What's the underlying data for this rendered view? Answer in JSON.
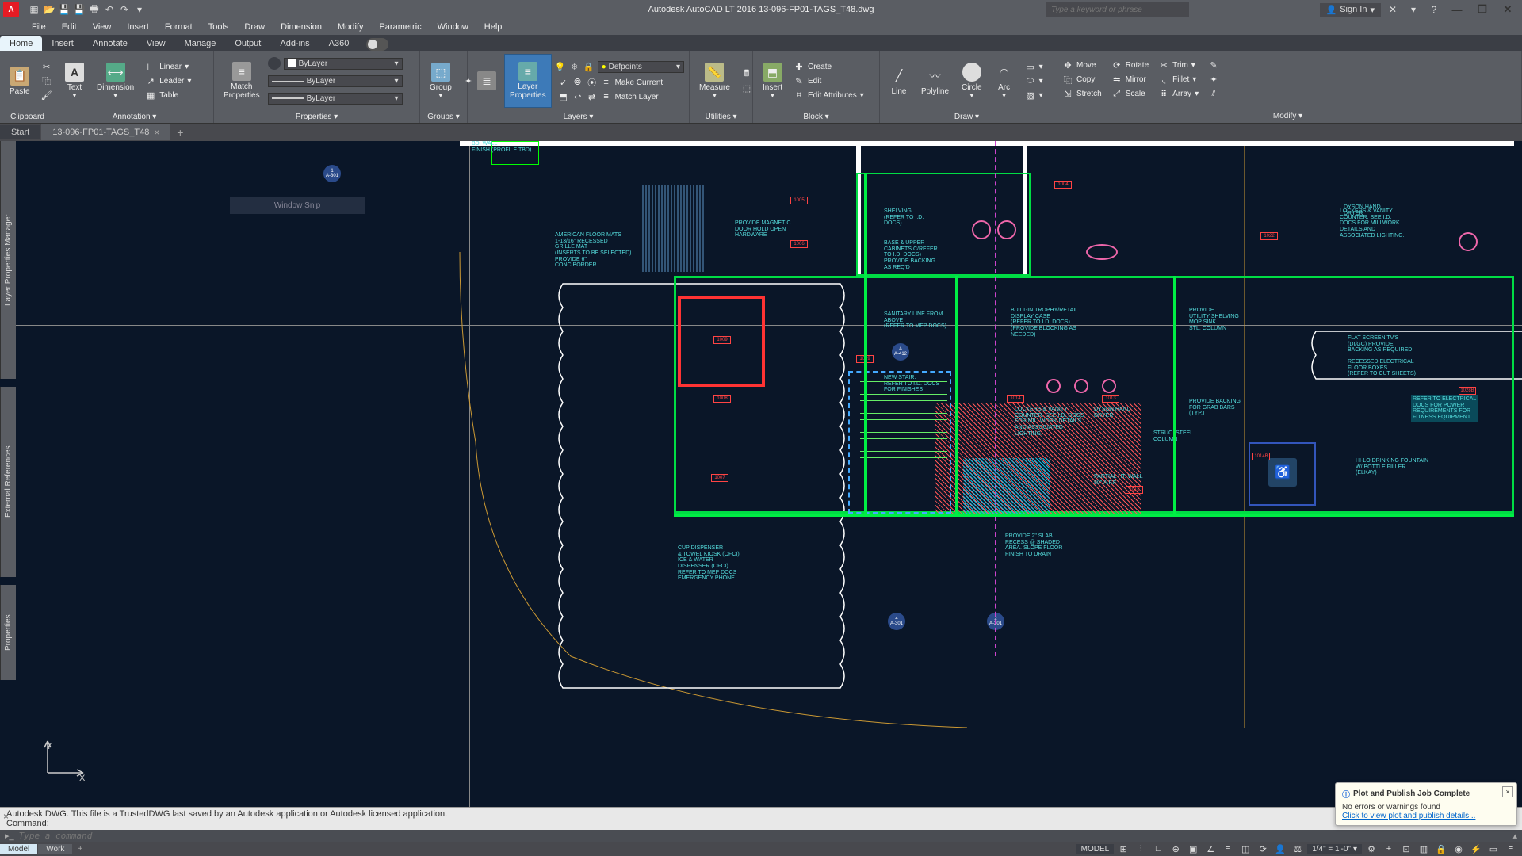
{
  "app": {
    "name": "A",
    "title": "Autodesk AutoCAD LT 2016   13-096-FP01-TAGS_T48.dwg"
  },
  "qat": [
    "new",
    "open",
    "save",
    "saveas",
    "plot",
    "undo",
    "redo"
  ],
  "search_placeholder": "Type a keyword or phrase",
  "signin": "Sign In",
  "menubar": [
    "File",
    "Edit",
    "View",
    "Insert",
    "Format",
    "Tools",
    "Draw",
    "Dimension",
    "Modify",
    "Parametric",
    "Window",
    "Help"
  ],
  "ribbon_tabs": [
    "Home",
    "Insert",
    "Annotate",
    "View",
    "Manage",
    "Output",
    "Add-ins",
    "A360"
  ],
  "ribbon_active": 0,
  "panels": {
    "clipboard": {
      "title": "Clipboard",
      "paste": "Paste"
    },
    "annotation": {
      "title": "Annotation ▾",
      "text": "Text",
      "dim": "Dimension",
      "linear": "Linear",
      "leader": "Leader",
      "table": "Table"
    },
    "properties": {
      "title": "Properties ▾",
      "match": "Match\nProperties",
      "color": "ByLayer",
      "ltype": "ByLayer",
      "lweight": "ByLayer"
    },
    "groups": {
      "title": "Groups ▾",
      "group": "Group"
    },
    "layers": {
      "title": "Layers ▾",
      "lp": "Layer\nProperties",
      "layer_dd": "Defpoints",
      "make_current": "Make Current",
      "match": "Match Layer"
    },
    "utilities": {
      "title": "Utilities ▾",
      "measure": "Measure"
    },
    "block": {
      "title": "Block ▾",
      "insert": "Insert",
      "create": "Create",
      "edit": "Edit",
      "editattr": "Edit Attributes"
    },
    "draw": {
      "title": "Draw ▾",
      "line": "Line",
      "pline": "Polyline",
      "circle": "Circle",
      "arc": "Arc"
    },
    "modify": {
      "title": "Modify ▾",
      "move": "Move",
      "copy": "Copy",
      "stretch": "Stretch",
      "rotate": "Rotate",
      "mirror": "Mirror",
      "scale": "Scale",
      "trim": "Trim",
      "fillet": "Fillet",
      "array": "Array"
    }
  },
  "file_tabs": {
    "start": "Start",
    "doc": "13-096-FP01-TAGS_T48"
  },
  "palettes": {
    "layer": "Layer Properties Manager",
    "xref": "External References",
    "props": "Properties"
  },
  "ucs": {
    "x": "X",
    "y": "Y"
  },
  "window_snip": "Window Snip",
  "cmd": {
    "hist1": "Autodesk DWG.  This file is a TrustedDWG last saved by an Autodesk application or Autodesk licensed application.",
    "hist2": "Command:",
    "placeholder": "Type a command"
  },
  "notif": {
    "title": "Plot and Publish Job Complete",
    "body": "No errors or warnings found",
    "link": "Click to view plot and publish details..."
  },
  "statusbar": {
    "tabs": [
      "Model",
      "Work"
    ],
    "model": "MODEL",
    "scale": "1/4\" = 1'-0\""
  },
  "drawing_labels": {
    "mats": "AMERICAN FLOOR MATS\n1-13/16\" RECESSED\nGRILLE MAT\n(INSERTS TO BE SELECTED)\nPROVIDE 6\"\nCONC BORDER",
    "magnetic": "PROVIDE MAGNETIC\nDOOR HOLD OPEN\nHARDWARE",
    "shelving": "SHELVING\n(REFER TO I.D.\nDOCS)",
    "cabinets": "BASE & UPPER\nCABINETS C/REFER\nTO I.D. DOCS)\nPROVIDE BACKING\nAS REQ'D",
    "stair": "NEW STAIR.\nREFER TO I.D. DOCS\nFOR FINISHES",
    "sanitary": "SANITARY LINE FROM\nABOVE\n(REFER TO MEP DOCS)",
    "trophy": "BUILT-IN TROPHY/RETAIL\nDISPLAY CASE\n(REFER TO I.D. DOCS)\n(PROVIDE BLOCKING AS\nNEEDED)",
    "mop": "PROVIDE\nUTILITY SHELVING\nMOP SINK\nSTL. COLUMN",
    "dryer": "DYSON HAND\nDRYER",
    "lockers": "LOCKERS & VANITY\nCOUNTER. SEE I.D.\nDOCS FOR MILLWORK\nDETAILS AND\nASSOCIATED LIGHTING.",
    "tv": "FLAT SCREEN TV'S\n(DI/GC) PROVIDE\nBACKING AS REQUIRED",
    "elecbox": "RECESSED ELECTRICAL\nFLOOR BOXES.\n(REFER TO CUT SHEETS)",
    "fitness": "REFER TO ELECTRICAL\nDOCS FOR POWER\nREQUIREMENTS FOR\nFITNESS EQUIPMENT",
    "fountain": "HI-LO DRINKING FOUNTAIN\nW/ BOTTLE FILLER\n(ELKAY)",
    "lockers2": "LOCKERS & VANITY\nCOUNTER. SEE I.D. DOCS\nFOR MILLWORK DETAILS\nAND ASSOCIATED\nLIGHTING.",
    "grabbar": "PROVIDE BACKING\nFOR GRAB BARS\n(TYP.)",
    "struc": "STRUC. STEEL\nCOLUMN",
    "partial": "PARTIAL HT. WALL\n80\" A.F.F",
    "slab": "PROVIDE 2\" SLAB\nRECESS @ SHADED\nAREA.  SLOPE FLOOR\nFINISH TO DRAIN",
    "cup": "CUP DISPENSER\n& TOWEL KIOSK (OFCI)\nICE & WATER\nDISPENSER (OFCI)\nREFER TO MEP DOCS\nEMERGENCY PHONE",
    "finish": "BD. WALL\nFINISH (PROFILE TBD)"
  },
  "room_tags": [
    "1000",
    "1004",
    "1005",
    "1006",
    "1007",
    "1008",
    "1009"
  ]
}
